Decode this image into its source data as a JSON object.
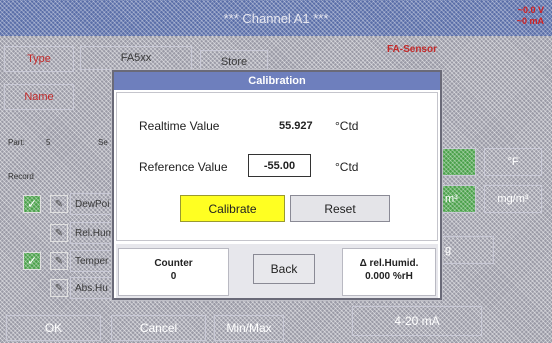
{
  "window": {
    "title": "*** Channel A1 ***",
    "readout_top": "~0.0 V",
    "readout_bottom": "~0 mA"
  },
  "background": {
    "type_label": "Type",
    "type_value": "FA5xx",
    "store_label": "Store",
    "sensor_label": "FA-Sensor",
    "name_label": "Name",
    "part_label": "Part:",
    "part_value": "5",
    "part_extra": "Se",
    "record_label": "Record",
    "records": [
      {
        "checked": true,
        "label": "DewPoi"
      },
      {
        "checked": false,
        "label": "Rel.Humi"
      },
      {
        "checked": true,
        "label": "Temper"
      },
      {
        "checked": false,
        "label": "Abs.Hu"
      }
    ],
    "unit_f": "°F",
    "unit_m3": "m³",
    "unit_mgm3": "mg/m³",
    "unit_g": "g",
    "ok_label": "OK",
    "cancel_label": "Cancel",
    "minmax_label": "Min/Max",
    "current_label": "4-20 mA"
  },
  "dialog": {
    "title": "Calibration",
    "realtime_label": "Realtime Value",
    "realtime_value": "55.927",
    "realtime_unit": "°Ctd",
    "reference_label": "Reference Value",
    "reference_value": "-55.00",
    "reference_unit": "°Ctd",
    "calibrate_label": "Calibrate",
    "reset_label": "Reset",
    "counter_label": "Counter",
    "counter_value": "0",
    "back_label": "Back",
    "delta_label": "Δ rel.Humid.",
    "delta_value": "0.000 %rH"
  }
}
